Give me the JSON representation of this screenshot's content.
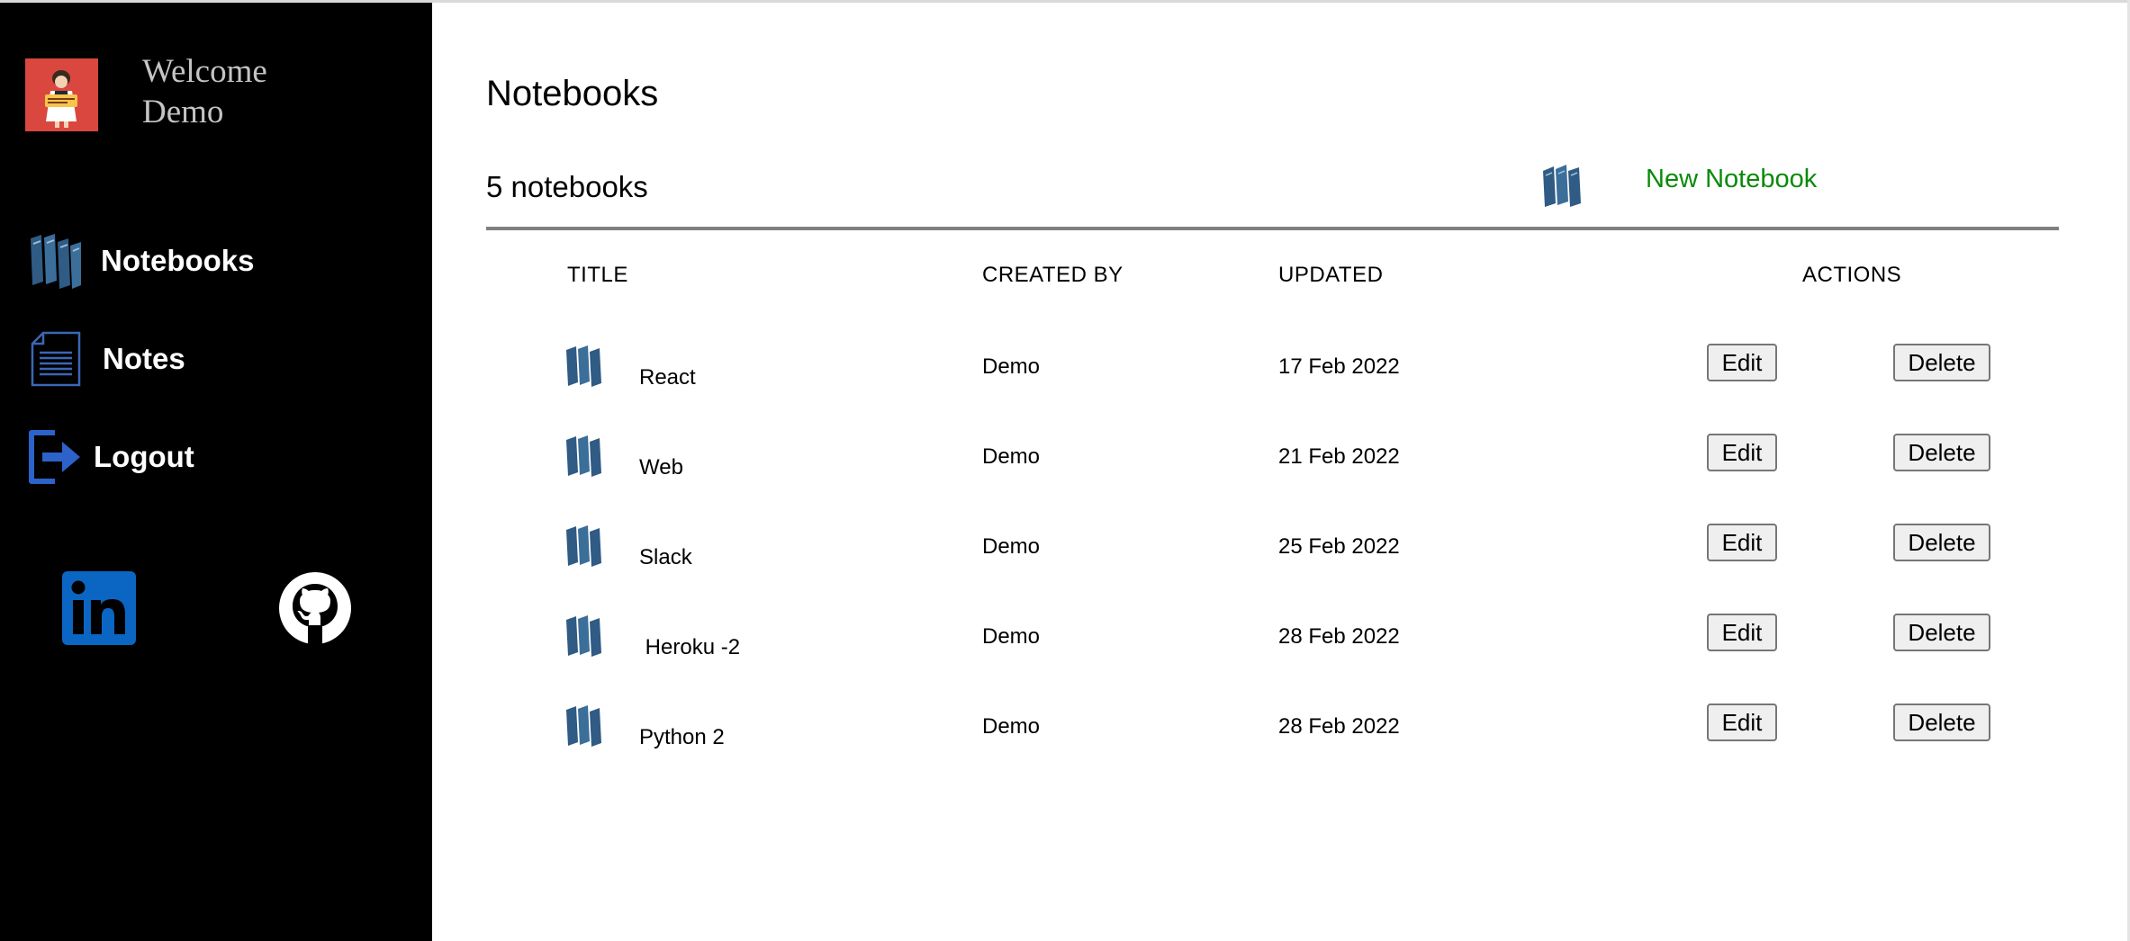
{
  "sidebar": {
    "welcome_line1": "Welcome",
    "welcome_line2": "Demo",
    "nav": [
      {
        "label": "Notebooks",
        "icon": "notebooks-icon"
      },
      {
        "label": "Notes",
        "icon": "notes-icon"
      },
      {
        "label": "Logout",
        "icon": "logout-icon"
      }
    ],
    "social": [
      "linkedin-icon",
      "github-icon"
    ]
  },
  "main": {
    "title": "Notebooks",
    "count_text": "5 notebooks",
    "new_notebook_label": "New Notebook",
    "table": {
      "headers": [
        "TITLE",
        "CREATED BY",
        "UPDATED",
        "ACTIONS"
      ],
      "rows": [
        {
          "title": "React",
          "created_by": "Demo",
          "updated": "17 Feb 2022"
        },
        {
          "title": "Web",
          "created_by": "Demo",
          "updated": "21 Feb 2022"
        },
        {
          "title": "Slack",
          "created_by": "Demo",
          "updated": "25 Feb 2022"
        },
        {
          "title": " Heroku -2",
          "created_by": "Demo",
          "updated": "28 Feb 2022"
        },
        {
          "title": "Python 2",
          "created_by": "Demo",
          "updated": "28 Feb 2022"
        }
      ],
      "edit_label": "Edit",
      "delete_label": "Delete"
    }
  },
  "colors": {
    "sidebar_bg": "#000000",
    "avatar_bg": "#d9473f",
    "book_icon": "#2f5b84",
    "nav_icon": "#3c66b5",
    "logout_icon": "#2d62c9",
    "new_notebook_link": "#0a8a0a",
    "linkedin": "#0a66c2"
  }
}
